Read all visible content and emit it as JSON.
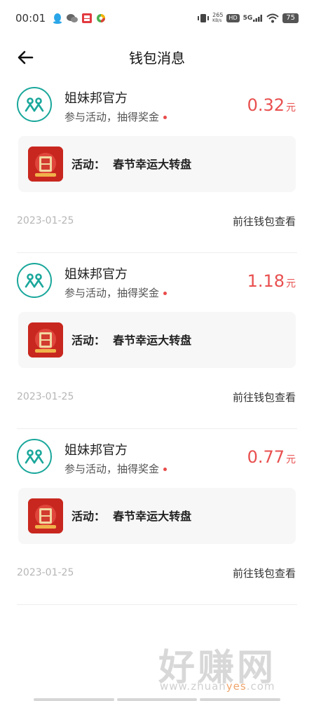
{
  "status_bar": {
    "time": "00:01",
    "net_speed_value": "265",
    "net_speed_unit": "KB/s",
    "hd": "HD",
    "network": "5G",
    "battery": "75"
  },
  "nav": {
    "title": "钱包消息"
  },
  "messages": [
    {
      "sender": "姐妹邦官方",
      "subtitle": "参与活动，抽得奖金",
      "amount": "0.32",
      "unit": "元",
      "activity_prefix": "活动：",
      "activity_name": "春节幸运大转盘",
      "date": "2023-01-25",
      "link": "前往钱包查看"
    },
    {
      "sender": "姐妹邦官方",
      "subtitle": "参与活动，抽得奖金",
      "amount": "1.18",
      "unit": "元",
      "activity_prefix": "活动：",
      "activity_name": "春节幸运大转盘",
      "date": "2023-01-25",
      "link": "前往钱包查看"
    },
    {
      "sender": "姐妹邦官方",
      "subtitle": "参与活动，抽得奖金",
      "amount": "0.77",
      "unit": "元",
      "activity_prefix": "活动：",
      "activity_name": "春节幸运大转盘",
      "date": "2023-01-25",
      "link": "前往钱包查看"
    }
  ],
  "watermark": {
    "title": "好赚网",
    "domain_a": "www.zhuan",
    "domain_b": "yes",
    "domain_c": ".com"
  },
  "colors": {
    "accent_teal": "#1aa79b",
    "amount_red": "#e94f4f",
    "activity_red": "#c8271f"
  },
  "icons": [
    "qq-icon",
    "wechat-icon",
    "app-icon",
    "colorful-app-icon",
    "vibrate-icon",
    "wifi-icon",
    "signal-icon",
    "back-arrow-icon",
    "official-avatar-icon",
    "red-dot-icon"
  ]
}
